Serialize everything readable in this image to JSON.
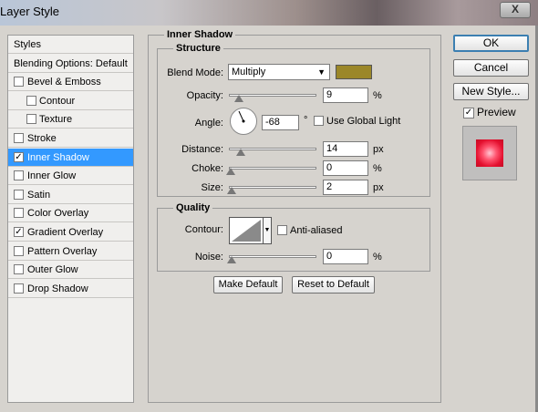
{
  "window": {
    "title": "Layer Style",
    "close_label": "X"
  },
  "styles_panel": {
    "items": [
      {
        "label": "Styles",
        "has_checkbox": false,
        "checked": false,
        "indent": false,
        "selected": false
      },
      {
        "label": "Blending Options: Default",
        "has_checkbox": false,
        "checked": false,
        "indent": false,
        "selected": false
      },
      {
        "label": "Bevel & Emboss",
        "has_checkbox": true,
        "checked": false,
        "indent": false,
        "selected": false
      },
      {
        "label": "Contour",
        "has_checkbox": true,
        "checked": false,
        "indent": true,
        "selected": false
      },
      {
        "label": "Texture",
        "has_checkbox": true,
        "checked": false,
        "indent": true,
        "selected": false
      },
      {
        "label": "Stroke",
        "has_checkbox": true,
        "checked": false,
        "indent": false,
        "selected": false
      },
      {
        "label": "Inner Shadow",
        "has_checkbox": true,
        "checked": true,
        "indent": false,
        "selected": true
      },
      {
        "label": "Inner Glow",
        "has_checkbox": true,
        "checked": false,
        "indent": false,
        "selected": false
      },
      {
        "label": "Satin",
        "has_checkbox": true,
        "checked": false,
        "indent": false,
        "selected": false
      },
      {
        "label": "Color Overlay",
        "has_checkbox": true,
        "checked": false,
        "indent": false,
        "selected": false
      },
      {
        "label": "Gradient Overlay",
        "has_checkbox": true,
        "checked": true,
        "indent": false,
        "selected": false
      },
      {
        "label": "Pattern Overlay",
        "has_checkbox": true,
        "checked": false,
        "indent": false,
        "selected": false
      },
      {
        "label": "Outer Glow",
        "has_checkbox": true,
        "checked": false,
        "indent": false,
        "selected": false
      },
      {
        "label": "Drop Shadow",
        "has_checkbox": true,
        "checked": false,
        "indent": false,
        "selected": false
      }
    ]
  },
  "inner_shadow": {
    "group_title": "Inner Shadow",
    "structure": {
      "title": "Structure",
      "blend_mode_label": "Blend Mode:",
      "blend_mode_value": "Multiply",
      "shadow_color": "#9b8729",
      "opacity_label": "Opacity:",
      "opacity_value": "9",
      "opacity_unit": "%",
      "angle_label": "Angle:",
      "angle_value": "-68",
      "angle_unit": "°",
      "global_light_label": "Use Global Light",
      "global_light_checked": false,
      "distance_label": "Distance:",
      "distance_value": "14",
      "distance_unit": "px",
      "choke_label": "Choke:",
      "choke_value": "0",
      "choke_unit": "%",
      "size_label": "Size:",
      "size_value": "2",
      "size_unit": "px"
    },
    "quality": {
      "title": "Quality",
      "contour_label": "Contour:",
      "anti_aliased_label": "Anti-aliased",
      "anti_aliased_checked": false,
      "noise_label": "Noise:",
      "noise_value": "0",
      "noise_unit": "%"
    },
    "make_default_label": "Make Default",
    "reset_default_label": "Reset to Default"
  },
  "actions": {
    "ok_label": "OK",
    "cancel_label": "Cancel",
    "new_style_label": "New Style...",
    "preview_label": "Preview",
    "preview_checked": true,
    "preview_color": "#e4102f"
  }
}
